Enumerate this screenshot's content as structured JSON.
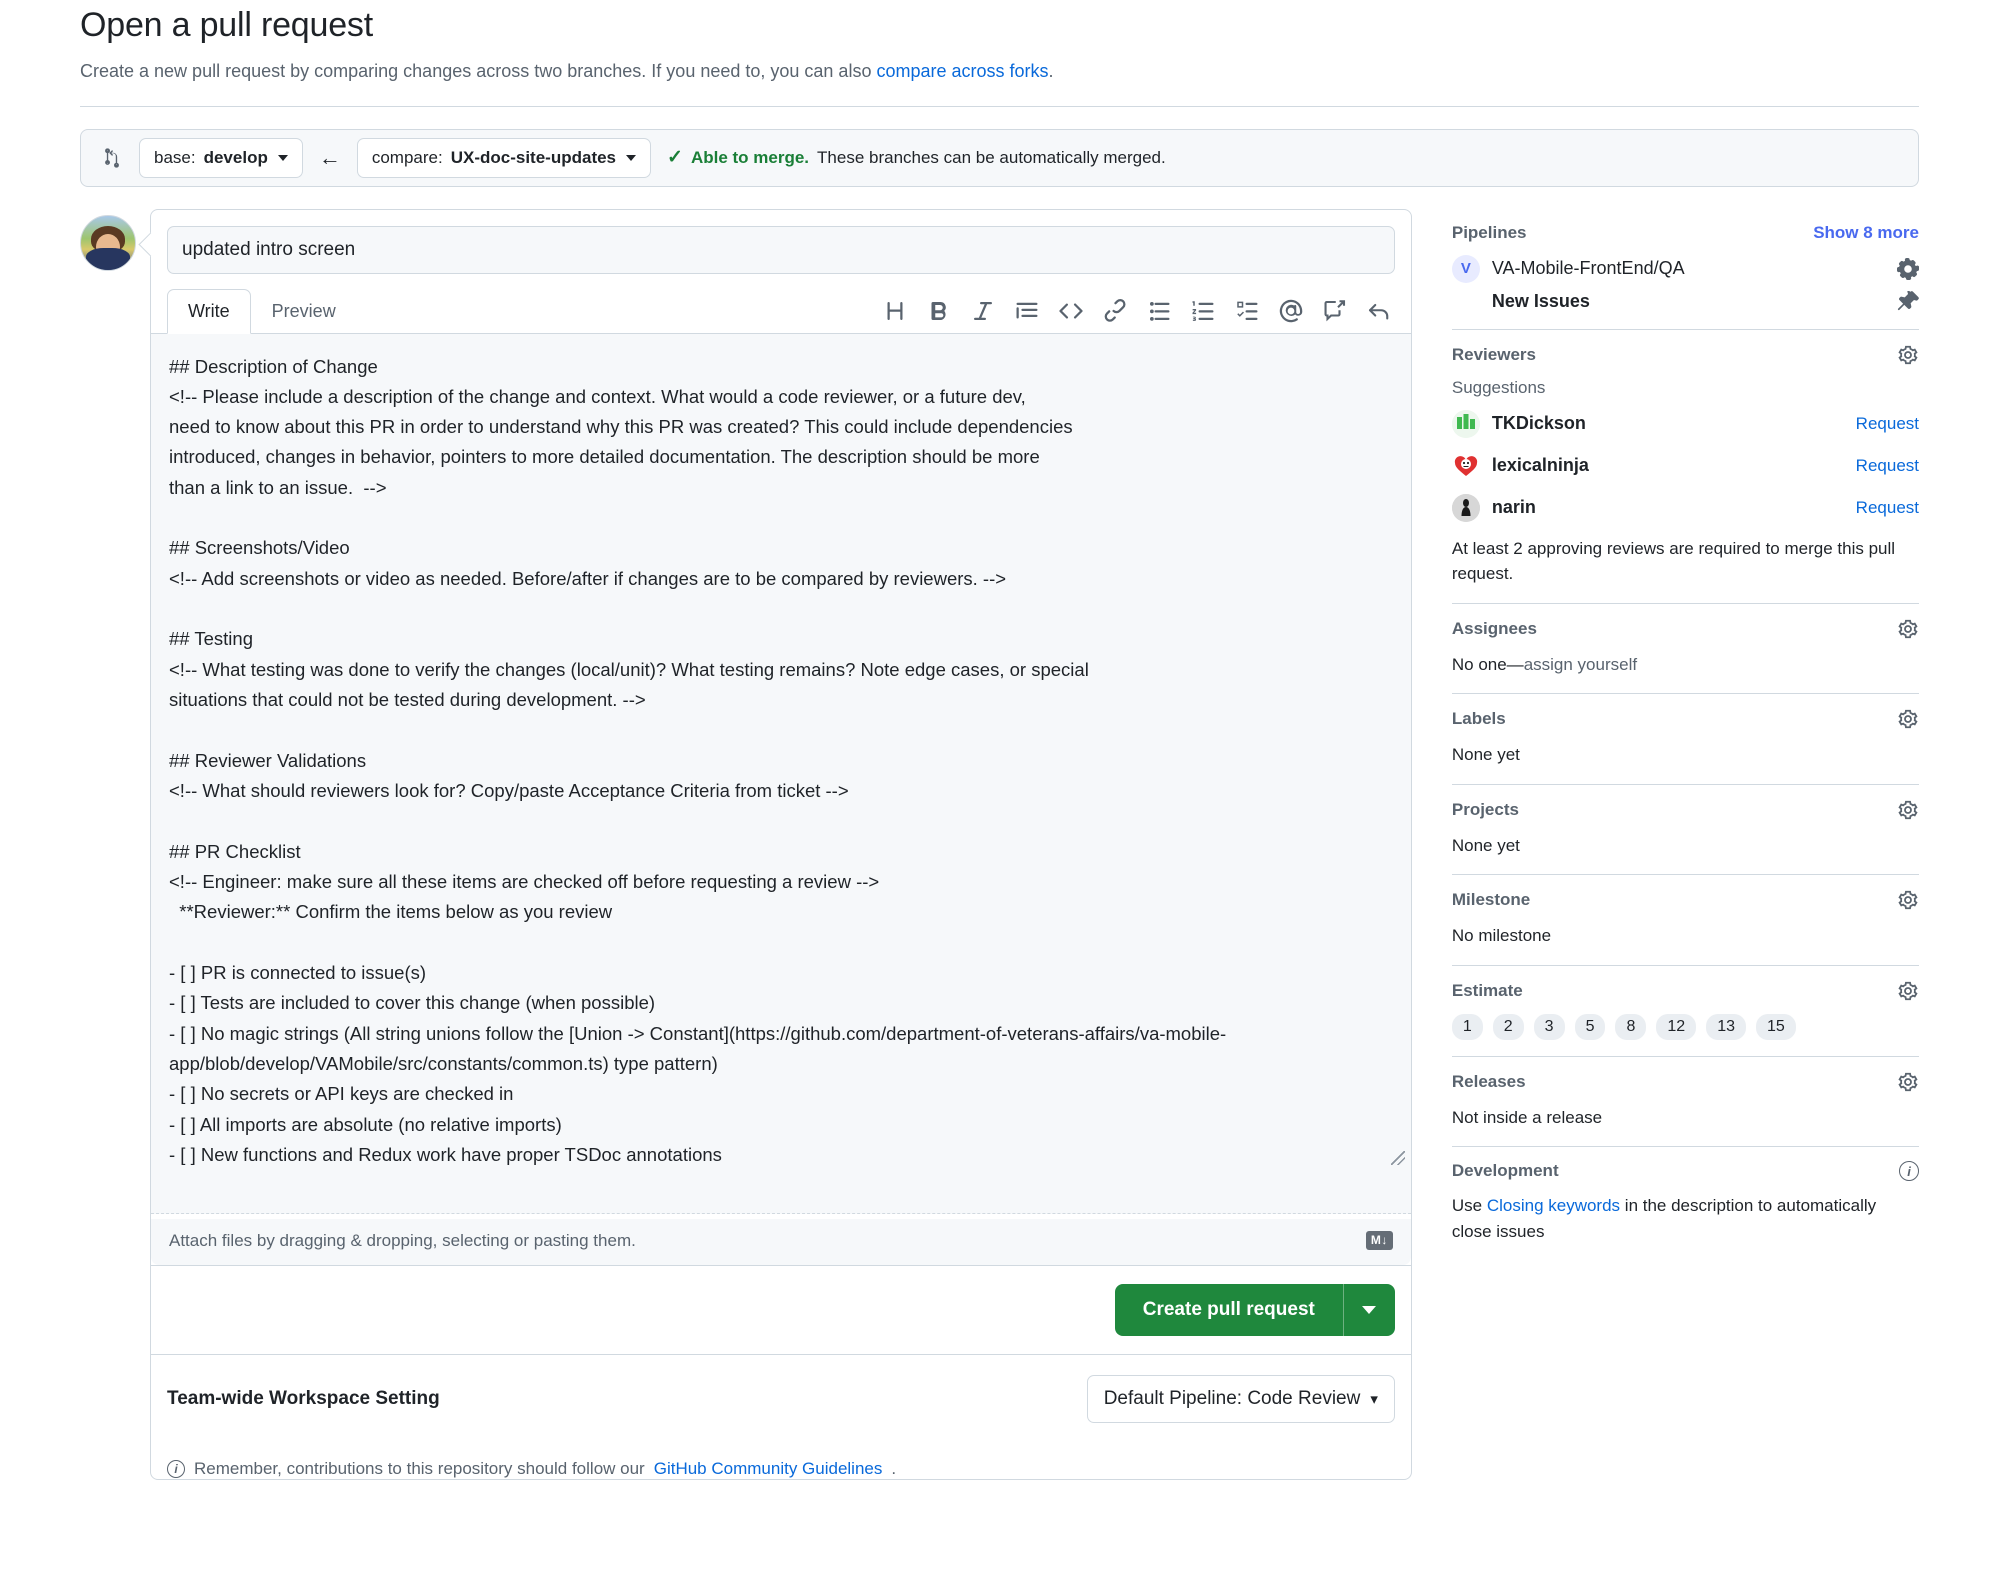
{
  "header": {
    "title": "Open a pull request",
    "subtitle_before": "Create a new pull request by comparing changes across two branches. If you need to, you can also ",
    "subtitle_link": "compare across forks",
    "subtitle_after": "."
  },
  "branchbar": {
    "compare_icon": "compare-branches-icon",
    "base_prefix": "base: ",
    "base_branch": "develop",
    "arrow": "←",
    "compare_prefix": "compare: ",
    "compare_branch": "UX-doc-site-updates",
    "check": "✓",
    "status_bold": "Able to merge.",
    "status_rest": " These branches can be automatically merged."
  },
  "comment": {
    "title_value": "updated intro screen",
    "title_placeholder": "Title",
    "tabs": [
      {
        "label": "Write",
        "active": true
      },
      {
        "label": "Preview",
        "active": false
      }
    ],
    "toolbar": [
      {
        "name": "heading-icon",
        "glyph": "H"
      },
      {
        "name": "bold-icon",
        "glyph": "B"
      },
      {
        "name": "italic-icon",
        "glyph": "I"
      },
      {
        "name": "quote-icon",
        "glyph": "quote"
      },
      {
        "name": "code-icon",
        "glyph": "<>"
      },
      {
        "name": "link-icon",
        "glyph": "link"
      },
      {
        "name": "unordered-list-icon",
        "glyph": "ul"
      },
      {
        "name": "ordered-list-icon",
        "glyph": "ol"
      },
      {
        "name": "task-list-icon",
        "glyph": "task"
      },
      {
        "name": "mention-icon",
        "glyph": "@"
      },
      {
        "name": "saved-reply-icon",
        "glyph": "reply-box"
      },
      {
        "name": "reference-icon",
        "glyph": "undo-arrow"
      }
    ],
    "body": "## Description of Change\n<!-- Please include a description of the change and context. What would a code reviewer, or a future dev,\nneed to know about this PR in order to understand why this PR was created? This could include dependencies\nintroduced, changes in behavior, pointers to more detailed documentation. The description should be more\nthan a link to an issue.  -->\n\n## Screenshots/Video\n<!-- Add screenshots or video as needed. Before/after if changes are to be compared by reviewers. -->\n\n## Testing\n<!-- What testing was done to verify the changes (local/unit)? What testing remains? Note edge cases, or special\nsituations that could not be tested during development. -->\n\n## Reviewer Validations\n<!-- What should reviewers look for? Copy/paste Acceptance Criteria from ticket -->\n\n## PR Checklist\n<!-- Engineer: make sure all these items are checked off before requesting a review -->\n  **Reviewer:** Confirm the items below as you review\n\n- [ ] PR is connected to issue(s)\n- [ ] Tests are included to cover this change (when possible)\n- [ ] No magic strings (All string unions follow the [Union -> Constant](https://github.com/department-of-veterans-affairs/va-mobile-app/blob/develop/VAMobile/src/constants/common.ts) type pattern)\n- [ ] No secrets or API keys are checked in\n- [ ] All imports are absolute (no relative imports)\n- [ ] New functions and Redux work have proper TSDoc annotations",
    "attach_text": "Attach files by dragging & dropping, selecting or pasting them.",
    "markdown_badge": "M↓",
    "create_button": "Create pull request",
    "workspace_label": "Team-wide Workspace Setting",
    "pipeline_select_value": "Default Pipeline: Code Review",
    "footer_before": "Remember, contributions to this repository should follow our ",
    "footer_link": "GitHub Community Guidelines",
    "footer_after": "."
  },
  "sidebar": {
    "pipelines": {
      "title": "Pipelines",
      "show_more": "Show 8 more",
      "repo_initial": "V",
      "repo_name": "VA-Mobile-FrontEnd/QA",
      "stage": "New Issues",
      "gear_icon": "gear-icon",
      "pin_icon": "pin-icon"
    },
    "reviewers": {
      "title": "Reviewers",
      "suggestions_label": "Suggestions",
      "people": [
        {
          "name": "TKDickson",
          "action": "Request",
          "avatar_color": "#3fb950"
        },
        {
          "name": "lexicalninja",
          "action": "Request",
          "avatar_color": "#e03131"
        },
        {
          "name": "narin",
          "action": "Request",
          "avatar_color": "#8b8b8b"
        }
      ],
      "note": "At least 2 approving reviews are required to merge this pull request."
    },
    "assignees": {
      "title": "Assignees",
      "value_prefix": "No one—",
      "value_link": "assign yourself"
    },
    "labels": {
      "title": "Labels",
      "value": "None yet"
    },
    "projects": {
      "title": "Projects",
      "value": "None yet"
    },
    "milestone": {
      "title": "Milestone",
      "value": "No milestone"
    },
    "estimate": {
      "title": "Estimate",
      "badges": [
        "1",
        "2",
        "3",
        "5",
        "8",
        "12",
        "13",
        "15"
      ]
    },
    "releases": {
      "title": "Releases",
      "value": "Not inside a release"
    },
    "development": {
      "title": "Development",
      "text_before": "Use ",
      "link": "Closing keywords",
      "text_after": " in the description to automatically close issues"
    }
  },
  "colors": {
    "accent_blue": "#0969da",
    "link_purple": "#4969ef",
    "success_green": "#1a7f37",
    "button_green": "#1f883d",
    "border": "#d1d9e0",
    "muted_text": "#59636e"
  }
}
